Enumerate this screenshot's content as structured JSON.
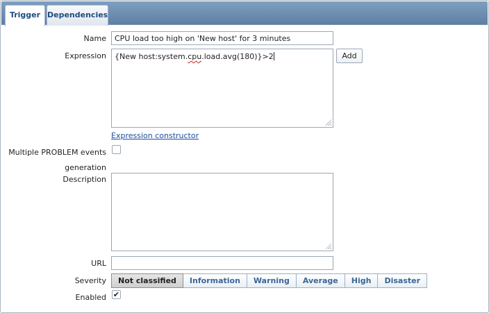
{
  "tabs": [
    {
      "label": "Trigger",
      "active": true
    },
    {
      "label": "Dependencies",
      "active": false
    }
  ],
  "form": {
    "name": {
      "label": "Name",
      "value": "CPU load too high on 'New host' for 3 minutes"
    },
    "expression": {
      "label": "Expression",
      "value_prefix": "{New host:system.",
      "value_misspelled": "cpu",
      "value_suffix": ".load.avg(180)}>2",
      "add_label": "Add"
    },
    "expression_constructor_link": "Expression constructor",
    "multiple_problem": {
      "label_line1": "Multiple PROBLEM events",
      "label_line2": "generation",
      "checked": false
    },
    "description": {
      "label": "Description",
      "value": ""
    },
    "url": {
      "label": "URL",
      "value": ""
    },
    "severity": {
      "label": "Severity",
      "options": [
        "Not classified",
        "Information",
        "Warning",
        "Average",
        "High",
        "Disaster"
      ],
      "selected": "Not classified"
    },
    "enabled": {
      "label": "Enabled",
      "checked": true,
      "check_glyph": "✔"
    }
  },
  "colors": {
    "tabbar": "#6f8fb2",
    "tab_text": "#1d4c80",
    "severity_text": "#3a6696",
    "link": "#1d4c9c"
  }
}
